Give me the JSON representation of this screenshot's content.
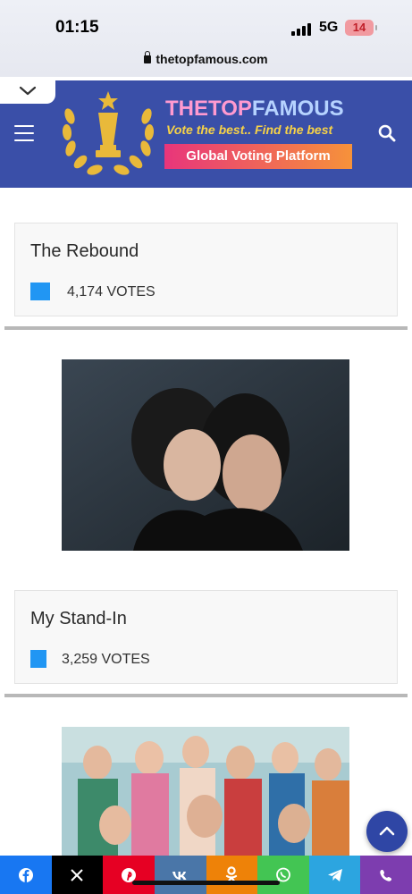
{
  "status_bar": {
    "time": "01:15",
    "network": "5G",
    "battery": "14",
    "url": "thetopfamous.com"
  },
  "header": {
    "brand_part1": "THETOP",
    "brand_part2": "FAMOUS",
    "tagline": "Vote the best.. Find the best",
    "platform_label": "Global Voting Platform",
    "colors": {
      "background": "#3a4fa8",
      "accent_gradient_start": "#e8357b",
      "accent_gradient_end": "#f6923a",
      "tagline": "#f7d247"
    }
  },
  "entries": [
    {
      "title": "The Rebound",
      "votes": "4,174 VOTES",
      "bar_color": "#2196f3"
    },
    {
      "title": "My Stand-In",
      "votes": "3,259 VOTES",
      "bar_color": "#2196f3"
    }
  ],
  "share_bar": [
    {
      "icon": "facebook-icon",
      "color": "#1877f2"
    },
    {
      "icon": "x-icon",
      "color": "#000000"
    },
    {
      "icon": "pinterest-icon",
      "color": "#e60023"
    },
    {
      "icon": "vk-icon",
      "color": "#4a76a8"
    },
    {
      "icon": "odnoklassniki-icon",
      "color": "#ee8208"
    },
    {
      "icon": "whatsapp-icon",
      "color": "#43c553"
    },
    {
      "icon": "telegram-icon",
      "color": "#2ca5e0"
    },
    {
      "icon": "viber-icon",
      "color": "#7d3daf"
    }
  ]
}
